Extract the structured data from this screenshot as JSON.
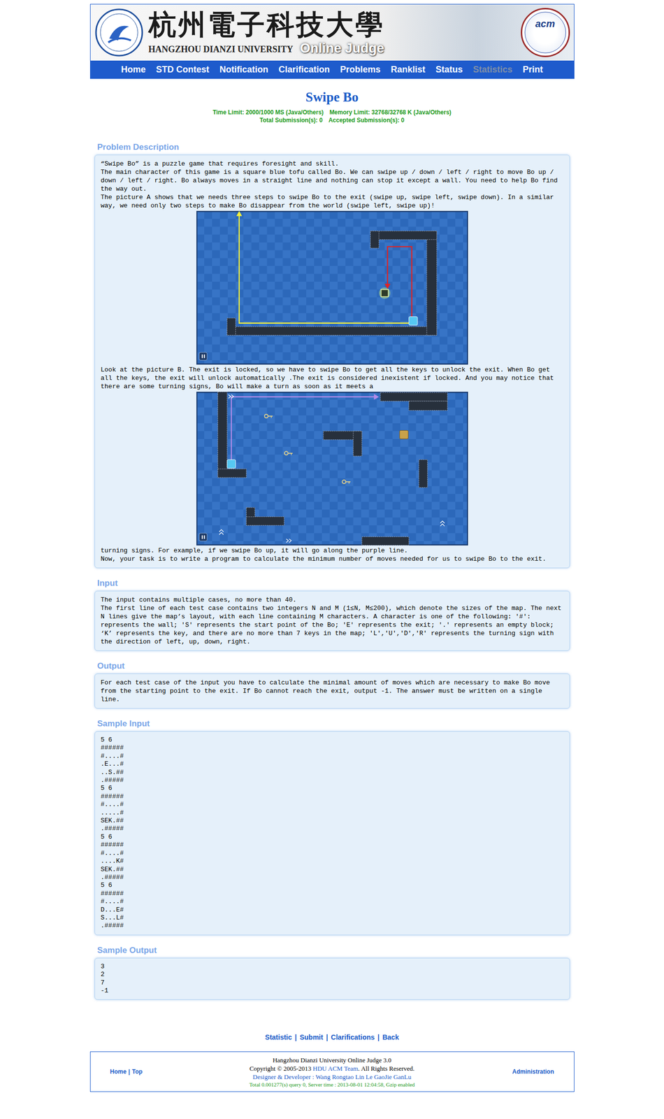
{
  "header": {
    "title_cn": "杭州電子科技大學",
    "title_en": "HANGZHOU DIANZI UNIVERSITY",
    "subtitle": "Online Judge",
    "badge": "acm"
  },
  "nav": [
    {
      "label": "Home",
      "disabled": false
    },
    {
      "label": "STD Contest",
      "disabled": false
    },
    {
      "label": "Notification",
      "disabled": false
    },
    {
      "label": "Clarification",
      "disabled": false
    },
    {
      "label": "Problems",
      "disabled": false
    },
    {
      "label": "Ranklist",
      "disabled": false
    },
    {
      "label": "Status",
      "disabled": false
    },
    {
      "label": "Statistics",
      "disabled": true
    },
    {
      "label": "Print",
      "disabled": false
    }
  ],
  "problem": {
    "title": "Swipe Bo",
    "limits": [
      "Time Limit: 2000/1000 MS (Java/Others)",
      "Memory Limit: 32768/32768 K (Java/Others)"
    ],
    "submissions": [
      "Total Submission(s): 0",
      "Accepted Submission(s): 0"
    ]
  },
  "sections": [
    {
      "heading": "Problem Description",
      "blocks": [
        {
          "kind": "text",
          "text": "“Swipe Bo” is a puzzle game that requires foresight and skill."
        },
        {
          "kind": "text",
          "text": "The main character of this game is a square blue tofu called Bo. We can swipe up / down / left / right to move Bo up / down / left / right. Bo always moves in a straight line and nothing can stop it except a wall. You need to help Bo find the way out."
        },
        {
          "kind": "text",
          "text": "The picture A shows that we needs three steps to swipe Bo to the exit (swipe up, swipe left, swipe down). In a similar way, we need only two steps to make Bo disappear from the world (swipe left, swipe up)!"
        },
        {
          "kind": "picture-a"
        },
        {
          "kind": "text",
          "text": "Look at the picture B. The exit is locked, so we have to swipe Bo to get all the keys to unlock the exit. When Bo get all the keys, the exit will unlock automatically .The exit is considered inexistent if locked. And you may notice that there are some turning signs, Bo will make a turn as soon as it meets a"
        },
        {
          "kind": "picture-b"
        },
        {
          "kind": "text",
          "text": "turning signs. For example, if we swipe Bo up, it will go along the purple line."
        },
        {
          "kind": "text",
          "text": "Now, your task is to write a program to calculate the minimum number of moves needed for us to swipe Bo to the exit."
        }
      ]
    },
    {
      "heading": "Input",
      "blocks": [
        {
          "kind": "text",
          "text": "The input contains multiple cases, no more than 40."
        },
        {
          "kind": "text",
          "text": "The first line of each test case contains two integers N and M (1≤N, M≤200), which denote the sizes of the map. The next N lines give the map’s layout, with each line containing M characters. A character is one of the following: '#': represents the wall; 'S' represents the start point of the Bo; 'E' represents the exit; '.' represents an empty block; ‘K’ represents the key, and there are no more than 7 keys in the map; 'L','U','D','R' represents the turning sign with the direction of left, up, down, right."
        }
      ]
    },
    {
      "heading": "Output",
      "blocks": [
        {
          "kind": "text",
          "text": "For each test case of the input you have to calculate the minimal amount of moves which are necessary to make Bo move from the starting point to the exit. If Bo cannot reach the exit, output -1. The answer must be written on a single line."
        }
      ]
    },
    {
      "heading": "Sample Input",
      "blocks": [
        {
          "kind": "code",
          "lines": [
            "5 6",
            "######",
            "#....#",
            ".E...#",
            "..S.##",
            ".#####",
            "5 6",
            "######",
            "#....#",
            ".....#",
            "SEK.##",
            ".#####",
            "5 6",
            "######",
            "#....#",
            "....K#",
            "SEK.##",
            ".#####",
            "5 6",
            "######",
            "#....#",
            "D...E#",
            "S...L#",
            ".#####"
          ]
        }
      ]
    },
    {
      "heading": "Sample Output",
      "blocks": [
        {
          "kind": "code",
          "lines": [
            "3",
            "2",
            "7",
            "-1"
          ]
        }
      ]
    }
  ],
  "links": {
    "items": [
      "Statistic",
      "Submit",
      "Clarifications",
      "Back"
    ],
    "separator": "|"
  },
  "footer": {
    "left": [
      "Home",
      "Top"
    ],
    "left_separator": "|",
    "title": "Hangzhou Dianzi University Online Judge 3.0",
    "copyright": [
      {
        "text": "Copyright © 2005-2013 ",
        "link": false
      },
      {
        "text": "HDU ACM Team",
        "link": true
      },
      {
        "text": ". All Rights Reserved.",
        "link": false
      }
    ],
    "designer": "Designer & Developer : Wang Rongtao Lin Le GaoJie GanLu",
    "server": "Total 0.001277(s) query 0, Server time : 2013-08-01 12:04:58, Gzip enabled",
    "right": "Administration"
  }
}
